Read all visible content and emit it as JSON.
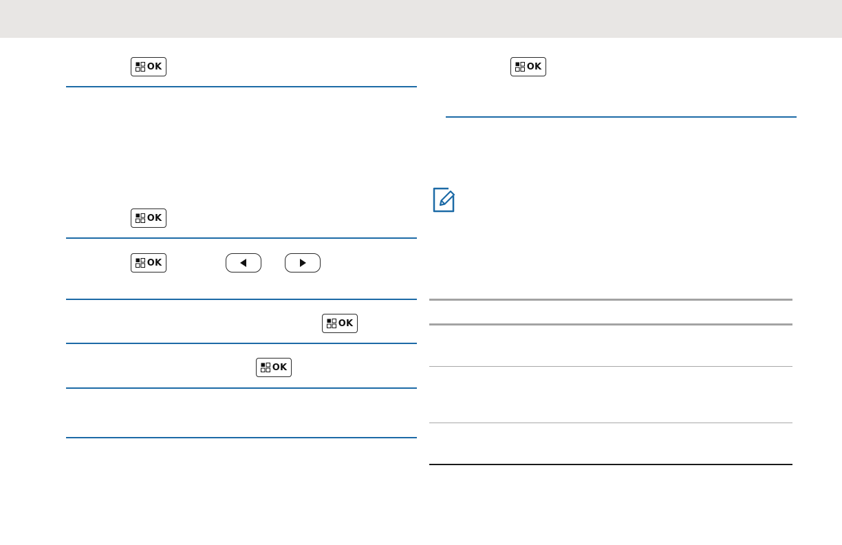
{
  "page": {
    "header_color": "#e8e6e4",
    "accent_color": "#1c6aa6"
  },
  "keys": {
    "ok_label": "OK",
    "menu_ok_icon": "menu-ok-key-icon",
    "left_arrow_icon": "left-arrow-key-icon",
    "right_arrow_icon": "right-arrow-key-icon",
    "note_icon": "note-pencil-icon"
  }
}
